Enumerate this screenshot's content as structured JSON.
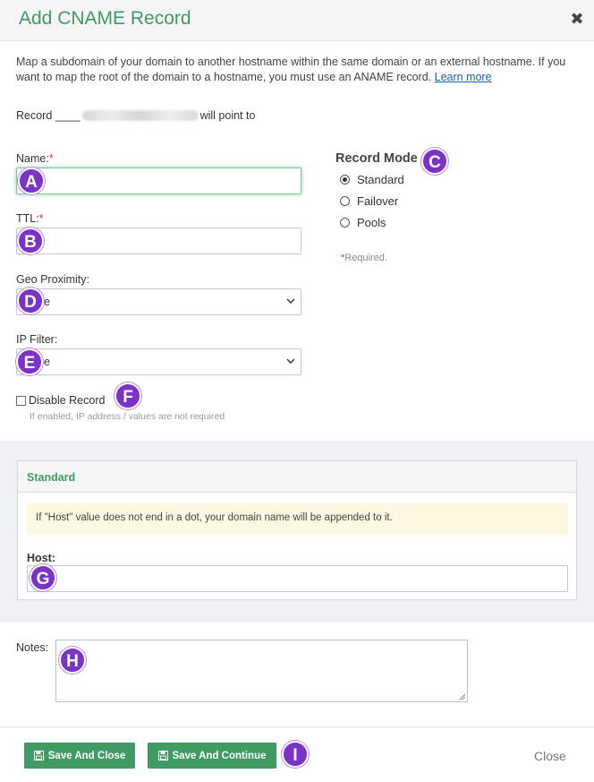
{
  "dialog": {
    "title": "Add CNAME Record",
    "description": "Map a subdomain of your domain to another hostname within the same domain or an external hostname. If you want to map the root of the domain to a hostname, you must use an ANAME record.",
    "learn_more": "Learn more",
    "record_prefix": "Record ____",
    "record_suffix": "will point to"
  },
  "fields": {
    "name_label": "Name:",
    "ttl_label": "TTL:",
    "required_star": "*",
    "geo_label": "Geo Proximity:",
    "geo_value": "e",
    "ip_filter_label": "IP Filter:",
    "ip_filter_value": "e",
    "disable_label": "Disable Record",
    "disable_hint": "If enabled, IP address / values are not required"
  },
  "record_mode": {
    "title": "Record Mode",
    "options": [
      "Standard",
      "Failover",
      "Pools"
    ],
    "selected": "Standard",
    "required_note": "Required."
  },
  "standard_panel": {
    "title": "Standard",
    "warning": "If \"Host\" value does not end in a dot, your domain name will be appended to it.",
    "host_label": "Host:"
  },
  "notes": {
    "label": "Notes:"
  },
  "footer": {
    "save_close": "Save And Close",
    "save_continue": "Save And Continue",
    "close": "Close"
  },
  "badges": [
    "A",
    "B",
    "C",
    "D",
    "E",
    "F",
    "G",
    "H",
    "I"
  ],
  "colors": {
    "accent": "#3f9b63",
    "badge": "#7b32c9",
    "required": "#d9302c",
    "warning_bg": "#fcf8e1"
  }
}
